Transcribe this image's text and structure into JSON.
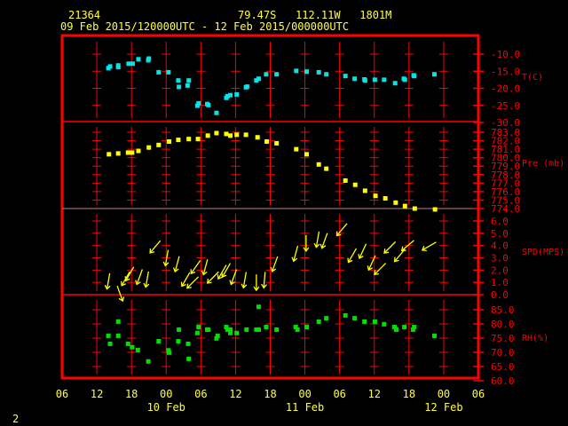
{
  "header": {
    "station_id": "21364",
    "location": "79.47S   112.11W   1801M",
    "period": "09 Feb 2015/120000UTC - 12 Feb 2015/000000UTC"
  },
  "page_number": "2",
  "colors": {
    "frame": "#ff0000",
    "axis_text": "#ff0000",
    "time_text": "#ffff40",
    "temperature": "#00e5e5",
    "pressure": "#ffff00",
    "wind": "#ffff00",
    "rh": "#00e000"
  },
  "chart_data": {
    "type": "scatter",
    "x_axis": {
      "range": [
        "09 06:00",
        "12 06:00"
      ],
      "tick_labels": [
        "06",
        "12",
        "18",
        "00",
        "06",
        "12",
        "18",
        "00",
        "06",
        "12",
        "18",
        "00",
        "06"
      ],
      "day_labels": [
        {
          "label": "10 Feb",
          "at": "10 00:00"
        },
        {
          "label": "11 Feb",
          "at": "11 00:00"
        },
        {
          "label": "12 Feb",
          "at": "12 00:00"
        }
      ]
    },
    "panels": [
      {
        "key": "temperature",
        "ylabel": "T(C)",
        "ylim": [
          -30,
          -4.5
        ],
        "yticks": [
          "-10.0",
          "-15.0",
          "-20.0",
          "-25.0",
          "-30.0"
        ],
        "ytick_values": [
          -10,
          -15,
          -20,
          -25,
          -30
        ],
        "points": [
          [
            "09 14:00",
            -14.1
          ],
          [
            "09 14:18",
            -13.6
          ],
          [
            "09 15:42",
            -13.3
          ],
          [
            "09 15:42",
            -13.8
          ],
          [
            "09 17:30",
            -12.8
          ],
          [
            "09 18:12",
            -12.8
          ],
          [
            "09 19:12",
            -11.5
          ],
          [
            "09 20:54",
            -11.8
          ],
          [
            "09 21:00",
            -11.3
          ],
          [
            "09 22:42",
            -15.3
          ],
          [
            "10 00:24",
            -15.3
          ],
          [
            "10 02:06",
            -17.7
          ],
          [
            "10 02:12",
            -19.6
          ],
          [
            "10 03:42",
            -19.2
          ],
          [
            "10 03:54",
            -17.7
          ],
          [
            "10 05:24",
            -25.1
          ],
          [
            "10 05:36",
            -24.4
          ],
          [
            "10 07:06",
            -24.6
          ],
          [
            "10 07:18",
            -24.9
          ],
          [
            "10 08:42",
            -27.2
          ],
          [
            "10 10:24",
            -22.8
          ],
          [
            "10 10:36",
            -22.3
          ],
          [
            "10 11:06",
            -22.0
          ],
          [
            "10 12:12",
            -21.8
          ],
          [
            "10 13:48",
            -19.7
          ],
          [
            "10 14:00",
            -19.5
          ],
          [
            "10 15:36",
            -17.7
          ],
          [
            "10 16:00",
            -17.2
          ],
          [
            "10 17:18",
            -15.9
          ],
          [
            "10 19:06",
            -15.9
          ],
          [
            "10 22:30",
            -14.9
          ],
          [
            "11 00:18",
            -15.1
          ],
          [
            "11 02:24",
            -15.3
          ],
          [
            "11 03:42",
            -15.9
          ],
          [
            "11 07:00",
            -16.4
          ],
          [
            "11 08:36",
            -17.2
          ],
          [
            "11 10:18",
            -17.4
          ],
          [
            "11 10:24",
            -17.7
          ],
          [
            "11 12:06",
            -17.5
          ],
          [
            "11 13:42",
            -17.5
          ],
          [
            "11 15:36",
            -18.5
          ],
          [
            "11 17:06",
            -17.2
          ],
          [
            "11 17:18",
            -17.5
          ],
          [
            "11 18:48",
            -16.2
          ],
          [
            "11 18:54",
            -16.4
          ],
          [
            "11 22:24",
            -15.9
          ]
        ]
      },
      {
        "key": "pressure",
        "ylabel": "Pre (mb)",
        "ylim": [
          774,
          783
        ],
        "yticks": [
          "783.0",
          "782.0",
          "781.0",
          "780.0",
          "779.0",
          "778.0",
          "777.0",
          "776.0",
          "775.0",
          "774.0"
        ],
        "ytick_values": [
          783,
          782,
          781,
          780,
          779,
          778,
          777,
          776,
          775,
          774
        ],
        "points": [
          [
            "09 14:06",
            780.4
          ],
          [
            "09 15:42",
            780.5
          ],
          [
            "09 17:24",
            780.6
          ],
          [
            "09 18:06",
            780.6
          ],
          [
            "09 19:12",
            780.8
          ],
          [
            "09 21:00",
            781.2
          ],
          [
            "09 22:42",
            781.5
          ],
          [
            "10 00:30",
            781.9
          ],
          [
            "10 02:06",
            782.1
          ],
          [
            "10 03:54",
            782.2
          ],
          [
            "10 05:30",
            782.2
          ],
          [
            "10 07:12",
            782.6
          ],
          [
            "10 08:42",
            782.9
          ],
          [
            "10 10:24",
            782.8
          ],
          [
            "10 11:06",
            782.6
          ],
          [
            "10 12:12",
            782.7
          ],
          [
            "10 13:48",
            782.7
          ],
          [
            "10 15:48",
            782.4
          ],
          [
            "10 17:24",
            781.9
          ],
          [
            "10 19:06",
            781.7
          ],
          [
            "10 22:30",
            781.0
          ],
          [
            "11 00:18",
            780.4
          ],
          [
            "11 02:24",
            779.2
          ],
          [
            "11 03:42",
            778.7
          ],
          [
            "11 07:00",
            777.3
          ],
          [
            "11 08:42",
            776.8
          ],
          [
            "11 10:24",
            776.1
          ],
          [
            "11 12:12",
            775.5
          ],
          [
            "11 13:54",
            775.2
          ],
          [
            "11 15:42",
            774.7
          ],
          [
            "11 17:18",
            774.3
          ],
          [
            "11 19:00",
            774.0
          ],
          [
            "11 22:30",
            773.9
          ]
        ]
      },
      {
        "key": "wind",
        "ylabel": "SPD(MPS)",
        "ylim": [
          0,
          7.2
        ],
        "yticks": [
          "6.0",
          "5.0",
          "4.0",
          "3.0",
          "2.0",
          "1.0",
          "0.0"
        ],
        "ytick_values": [
          6,
          5,
          4,
          3,
          2,
          1,
          0
        ],
        "points": [
          [
            "09 14:00",
            1.1,
            10
          ],
          [
            "09 16:00",
            0.1,
            340
          ],
          [
            "09 17:00",
            1.3,
            30
          ],
          [
            "09 17:42",
            1.7,
            30
          ],
          [
            "09 19:24",
            1.45,
            20
          ],
          [
            "09 20:42",
            1.25,
            10
          ],
          [
            "09 22:06",
            3.9,
            40
          ],
          [
            "10 00:06",
            3.0,
            10
          ],
          [
            "10 01:54",
            2.5,
            15
          ],
          [
            "10 03:24",
            1.25,
            30
          ],
          [
            "10 04:36",
            1.0,
            45
          ],
          [
            "10 05:06",
            2.25,
            35
          ],
          [
            "10 06:48",
            2.25,
            15
          ],
          [
            "10 08:06",
            1.4,
            45
          ],
          [
            "10 09:42",
            1.85,
            30
          ],
          [
            "10 10:24",
            2.0,
            30
          ],
          [
            "10 11:42",
            1.45,
            20
          ],
          [
            "10 13:36",
            1.2,
            10
          ],
          [
            "10 15:36",
            1.0,
            0
          ],
          [
            "10 17:00",
            1.2,
            5
          ],
          [
            "10 18:48",
            2.5,
            20
          ],
          [
            "10 22:24",
            3.35,
            15
          ],
          [
            "11 00:12",
            4.2,
            0
          ],
          [
            "11 02:12",
            4.5,
            10
          ],
          [
            "11 03:24",
            4.4,
            20
          ],
          [
            "11 06:24",
            5.3,
            40
          ],
          [
            "11 08:12",
            3.2,
            30
          ],
          [
            "11 10:00",
            3.55,
            25
          ],
          [
            "11 11:36",
            2.6,
            25
          ],
          [
            "11 13:00",
            2.1,
            45
          ],
          [
            "11 14:42",
            3.85,
            45
          ],
          [
            "11 16:24",
            3.2,
            40
          ],
          [
            "11 17:48",
            4.0,
            50
          ],
          [
            "11 21:30",
            3.95,
            60
          ]
        ]
      },
      {
        "key": "rh",
        "ylabel": "RH(%)",
        "ylim": [
          60,
          85.5
        ],
        "yticks": [
          "85.0",
          "80.0",
          "75.0",
          "70.0",
          "65.0",
          "60.0"
        ],
        "ytick_values": [
          85,
          80,
          75,
          70,
          65,
          60
        ],
        "points": [
          [
            "09 14:00",
            75.8
          ],
          [
            "09 14:18",
            73.0
          ],
          [
            "09 15:42",
            80.8
          ],
          [
            "09 15:42",
            75.8
          ],
          [
            "09 17:24",
            73.0
          ],
          [
            "09 18:06",
            71.8
          ],
          [
            "09 19:06",
            70.8
          ],
          [
            "09 20:54",
            66.8
          ],
          [
            "09 22:42",
            73.9
          ],
          [
            "10 00:24",
            70.7
          ],
          [
            "10 00:30",
            69.9
          ],
          [
            "10 02:06",
            73.9
          ],
          [
            "10 02:12",
            78.0
          ],
          [
            "10 03:48",
            73.0
          ],
          [
            "10 03:54",
            67.7
          ],
          [
            "10 05:24",
            76.8
          ],
          [
            "10 05:36",
            78.9
          ],
          [
            "10 07:06",
            78.0
          ],
          [
            "10 07:18",
            78.0
          ],
          [
            "10 08:42",
            74.9
          ],
          [
            "10 08:54",
            75.8
          ],
          [
            "10 10:24",
            78.9
          ],
          [
            "10 10:36",
            78.0
          ],
          [
            "10 11:06",
            78.0
          ],
          [
            "10 11:06",
            76.8
          ],
          [
            "10 12:12",
            76.8
          ],
          [
            "10 13:54",
            78.0
          ],
          [
            "10 15:36",
            78.0
          ],
          [
            "10 16:00",
            78.0
          ],
          [
            "10 16:00",
            86.0
          ],
          [
            "10 17:18",
            78.9
          ],
          [
            "10 19:06",
            78.0
          ],
          [
            "10 22:24",
            78.9
          ],
          [
            "10 22:42",
            78.0
          ],
          [
            "11 00:18",
            78.9
          ],
          [
            "11 02:24",
            80.8
          ],
          [
            "11 03:42",
            82.0
          ],
          [
            "11 07:00",
            83.0
          ],
          [
            "11 08:36",
            82.0
          ],
          [
            "11 10:18",
            80.8
          ],
          [
            "11 12:06",
            80.8
          ],
          [
            "11 13:42",
            79.9
          ],
          [
            "11 15:30",
            78.9
          ],
          [
            "11 15:48",
            78.0
          ],
          [
            "11 17:12",
            78.9
          ],
          [
            "11 18:42",
            78.0
          ],
          [
            "11 18:54",
            78.9
          ],
          [
            "11 22:24",
            75.8
          ]
        ]
      }
    ]
  }
}
